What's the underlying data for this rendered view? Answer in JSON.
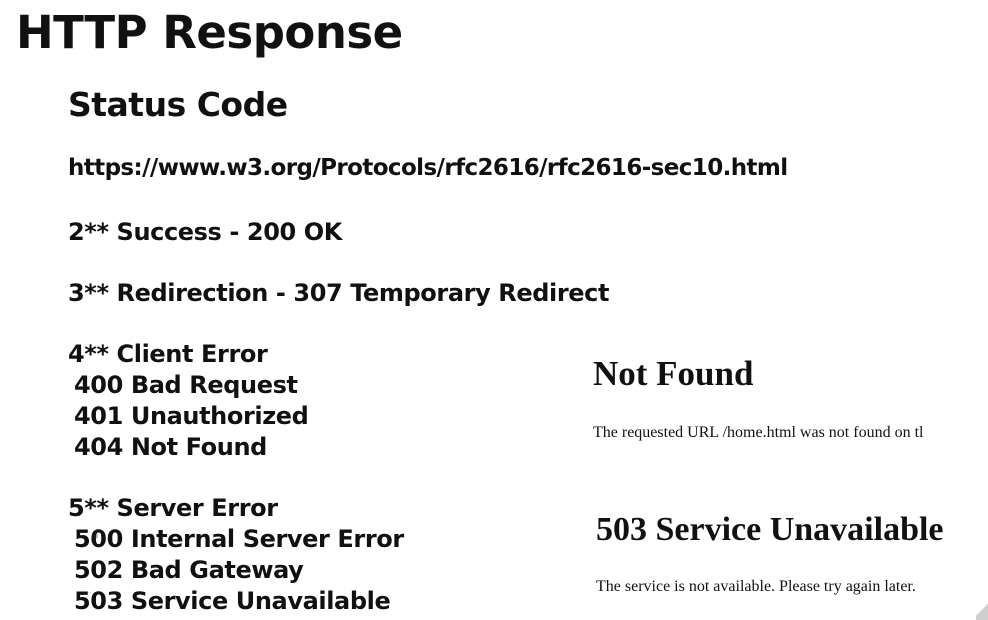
{
  "slide": {
    "title": "HTTP Response",
    "subtitle": "Status Code",
    "reference_url": "https://www.w3.org/Protocols/rfc2616/rfc2616-sec10.html",
    "success_line": "2** Success - 200 OK",
    "redirection_line": "3** Redirection - 307 Temporary Redirect",
    "client_error": {
      "heading": "4** Client Error",
      "codes": [
        "400 Bad Request",
        "401 Unauthorized",
        "404 Not Found"
      ]
    },
    "server_error": {
      "heading": "5** Server Error",
      "codes": [
        "500 Internal Server Error",
        "502 Bad Gateway",
        "503 Service Unavailable"
      ]
    }
  },
  "examples": {
    "not_found": {
      "heading": "Not Found",
      "message": "The requested URL /home.html was not found on tl"
    },
    "service_unavailable": {
      "heading": "503 Service Unavailable",
      "message": "The service is not available. Please try again later."
    }
  }
}
